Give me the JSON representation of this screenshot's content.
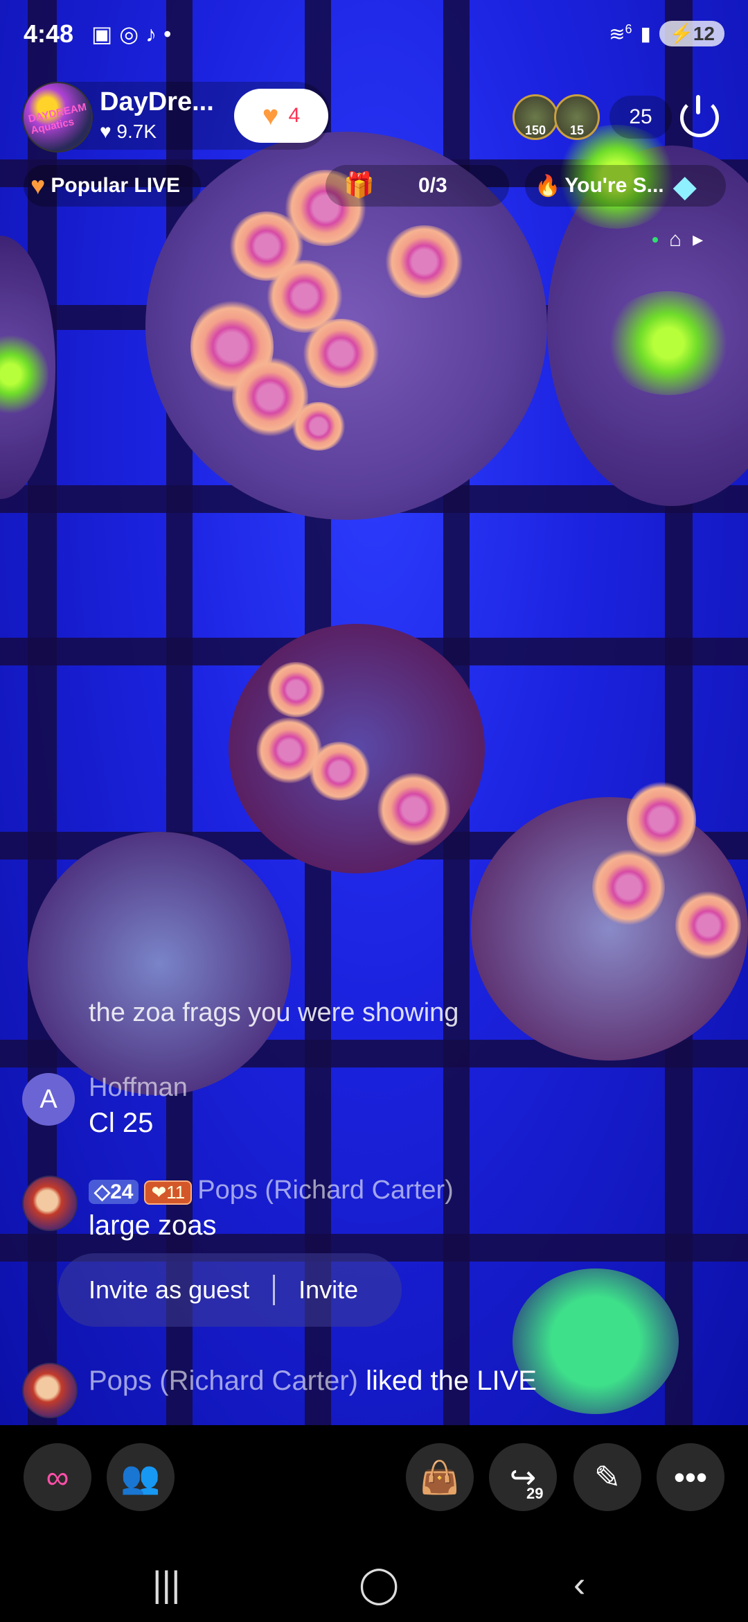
{
  "status_bar": {
    "time": "4:48",
    "network_superscript": "6",
    "battery": "12"
  },
  "host": {
    "avatar_text": "DAYDREAM Aquatics",
    "name": "DayDre...",
    "likes": "9.7K",
    "follow_count": "4"
  },
  "viewers": {
    "avatar1_badge": "150",
    "avatar2_badge": "15",
    "count": "25"
  },
  "pills": {
    "popular": "Popular LIVE",
    "goal": "0/3",
    "rank": "You're S..."
  },
  "chat": {
    "faded_line": "the zoa frags you were showing",
    "messages": [
      {
        "avatar_letter": "A",
        "username": "Hoffman",
        "text": "Cl 25"
      },
      {
        "gem_level": "24",
        "fan_badge": "11",
        "username": "Pops (Richard Carter)",
        "text": "large zoas"
      }
    ],
    "invite_guest": "Invite as guest",
    "invite": "Invite",
    "liked": {
      "username": "Pops (Richard Carter)",
      "action": "liked the LIVE"
    }
  },
  "bottom_bar": {
    "share_count": "29"
  },
  "colors": {
    "video_bg": "#1c23e0",
    "accent_pink": "#ff3355",
    "bottom_bar": "#000000"
  }
}
